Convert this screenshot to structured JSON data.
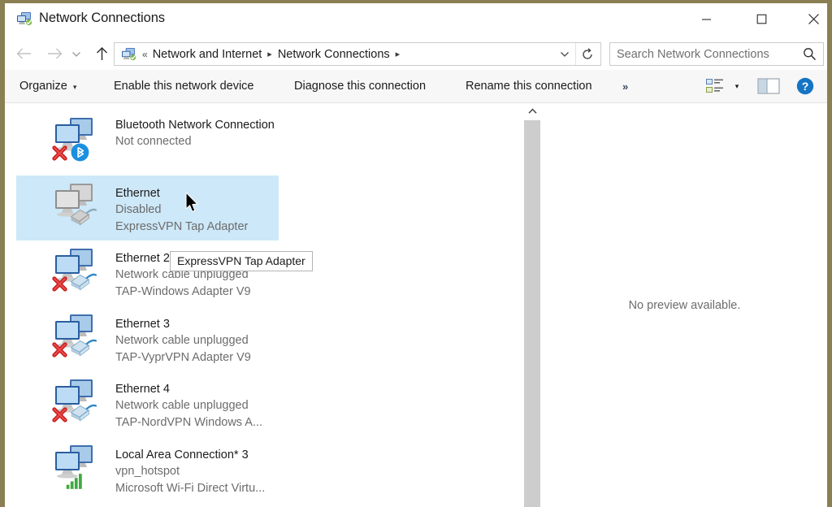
{
  "window": {
    "title": "Network Connections",
    "title_icon": "network-connections-icon",
    "minimize_label": "Minimize",
    "maximize_label": "Maximize",
    "close_label": "Close",
    "frame_color": "#8a7f52"
  },
  "navigation": {
    "back_label": "Back",
    "forward_label": "Forward",
    "recent_label": "Recent locations",
    "up_label": "Up one level",
    "breadcrumbs": [
      {
        "label": "Network and Internet"
      },
      {
        "label": "Network Connections"
      }
    ],
    "dropdown_label": "Previous locations",
    "refresh_label": "Refresh"
  },
  "search": {
    "placeholder": "Search Network Connections",
    "value": "",
    "icon": "search-icon"
  },
  "toolbar": {
    "organize_label": "Organize",
    "organize_caret": "▾",
    "enable_label": "Enable this network device",
    "diagnose_label": "Diagnose this connection",
    "rename_label": "Rename this connection",
    "more_label": "»",
    "view_icon": "change-view-icon",
    "view_caret": "▾",
    "preview_pane_icon": "preview-pane-icon",
    "help_icon": "help-icon",
    "help_label": "?"
  },
  "connections": [
    {
      "name": "Bluetooth Network Connection",
      "status": "Not connected",
      "device": "",
      "icon": "network-adapter-disconnected-icon",
      "badge": "bluetooth-icon",
      "error": true,
      "selected": false,
      "wrap_name": true
    },
    {
      "name": "Ethernet",
      "status": "Disabled",
      "device": "ExpressVPN Tap Adapter",
      "icon": "network-adapter-disabled-icon",
      "badge": "ethernet-plug-icon",
      "error": false,
      "selected": true,
      "wrap_name": false
    },
    {
      "name": "Ethernet 2",
      "status": "Network cable unplugged",
      "device": "TAP-Windows Adapter V9",
      "icon": "network-adapter-icon",
      "badge": "ethernet-plug-icon",
      "error": true,
      "selected": false,
      "wrap_name": false
    },
    {
      "name": "Ethernet 3",
      "status": "Network cable unplugged",
      "device": "TAP-VyprVPN Adapter V9",
      "icon": "network-adapter-icon",
      "badge": "ethernet-plug-icon",
      "error": true,
      "selected": false,
      "wrap_name": false
    },
    {
      "name": "Ethernet 4",
      "status": "Network cable unplugged",
      "device": "TAP-NordVPN Windows A...",
      "icon": "network-adapter-icon",
      "badge": "ethernet-plug-icon",
      "error": true,
      "selected": false,
      "wrap_name": false
    },
    {
      "name": "Local Area Connection* 3",
      "status": "vpn_hotspot",
      "device": "Microsoft Wi-Fi Direct Virtu...",
      "icon": "network-adapter-icon",
      "badge": "wifi-signal-icon",
      "error": false,
      "selected": false,
      "wrap_name": false
    }
  ],
  "tooltip": {
    "text": "ExpressVPN Tap Adapter"
  },
  "preview": {
    "message": "No preview available."
  },
  "scrollbar": {
    "up_label": "Scroll up"
  },
  "colors": {
    "selection": "#cde8f8",
    "accent": "#0078d7",
    "status_text": "#6c6c6c",
    "error": "#d01b1b",
    "signal": "#3faa3f"
  }
}
